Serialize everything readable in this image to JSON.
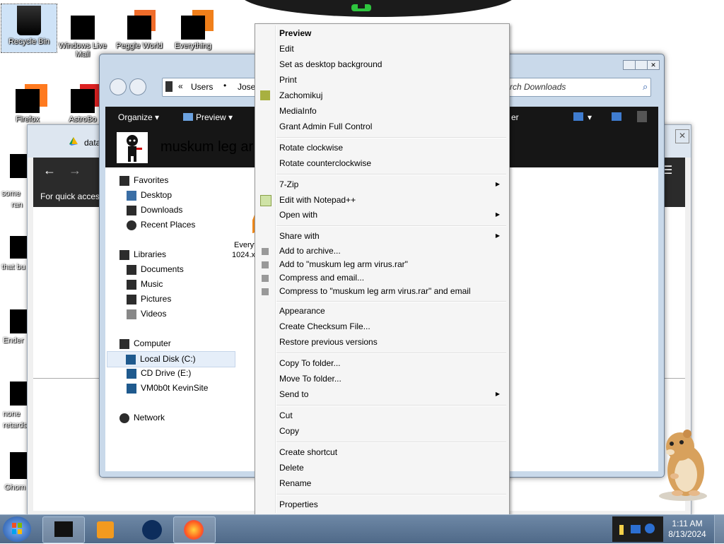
{
  "desktop": {
    "icons": [
      {
        "label": "Recycle Bin"
      },
      {
        "label": "Windows Live Mail"
      },
      {
        "label": "Peggle World"
      },
      {
        "label": "Everything"
      },
      {
        "label": "Firefox"
      },
      {
        "label": "AstroBo"
      }
    ],
    "side_clips": [
      "some",
      "ran",
      "that bu",
      "Ender",
      "none",
      "retards",
      "Ghom"
    ]
  },
  "browser_window": {
    "tab_label": "data",
    "quick_access_text": "For quick acces"
  },
  "explorer": {
    "breadcrumb": [
      "Users",
      "Jose"
    ],
    "search_placeholder": "rch Downloads",
    "toolbar": {
      "organize": "Organize",
      "preview": "Preview",
      "extra": "er"
    },
    "folder_title": "muskum leg ar",
    "nav": {
      "favorites": {
        "label": "Favorites",
        "items": [
          "Desktop",
          "Downloads",
          "Recent Places"
        ]
      },
      "libraries": {
        "label": "Libraries",
        "items": [
          "Documents",
          "Music",
          "Pictures",
          "Videos"
        ]
      },
      "computer": {
        "label": "Computer",
        "items": [
          "Local Disk (C:)",
          "CD Drive (E:)",
          "VM0b0t KevinSite"
        ]
      },
      "network": {
        "label": "Network"
      }
    },
    "file": {
      "name_line1": "Everyt",
      "name_line2": "1024.x"
    }
  },
  "context_menu": {
    "items": [
      {
        "label": "Preview",
        "bold": true
      },
      {
        "label": "Edit"
      },
      {
        "label": "Set as desktop background"
      },
      {
        "label": "Print"
      },
      {
        "label": "Zachomikuj"
      },
      {
        "label": "MediaInfo"
      },
      {
        "label": "Grant Admin Full Control"
      },
      {
        "label": "Rotate clockwise"
      },
      {
        "label": "Rotate counterclockwise"
      },
      {
        "label": "7-Zip"
      },
      {
        "label": "Edit with Notepad++"
      },
      {
        "label": "Open with"
      },
      {
        "label": "Share with"
      },
      {
        "label": "Add to archive..."
      },
      {
        "label": "Add to \"muskum leg arm virus.rar\""
      },
      {
        "label": "Compress and email..."
      },
      {
        "label": "Compress to \"muskum leg arm virus.rar\" and email"
      },
      {
        "label": "Appearance"
      },
      {
        "label": "Create Checksum File..."
      },
      {
        "label": "Restore previous versions"
      },
      {
        "label": "Copy To folder..."
      },
      {
        "label": "Move To folder..."
      },
      {
        "label": "Send to"
      },
      {
        "label": "Cut"
      },
      {
        "label": "Copy"
      },
      {
        "label": "Create shortcut"
      },
      {
        "label": "Delete"
      },
      {
        "label": "Rename"
      },
      {
        "label": "Properties"
      }
    ]
  },
  "taskbar": {
    "time": "1:11 AM",
    "date": "8/13/2024"
  },
  "colors": {
    "menu_bg": "#f5f5f5",
    "explorer_title": "#e97fd8",
    "taskbar": "#5b7595"
  }
}
